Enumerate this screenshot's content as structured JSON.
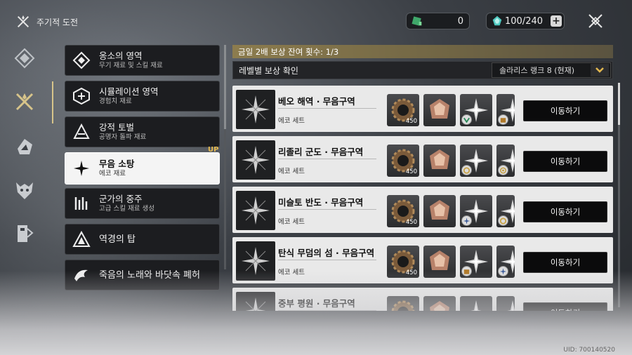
{
  "header": {
    "title": "주기적 도전"
  },
  "currency": {
    "green_value": "0",
    "stamina_value": "100/240"
  },
  "categories": [
    {
      "title": "옹소의 영역",
      "desc": "무기 재료 및 스킬 재료"
    },
    {
      "title": "시뮬레이션 영역",
      "desc": "경험치 재료"
    },
    {
      "title": "강적 토벌",
      "desc": "공명자 돌파 재료"
    },
    {
      "title": "무음 소탕",
      "desc": "에코 재료"
    },
    {
      "title": "군가의 중주",
      "desc": "고급 스킬 재료 생성"
    },
    {
      "title": "역경의 탑",
      "desc": ""
    },
    {
      "title": "죽음의 노래와 바닷속 폐허",
      "desc": ""
    }
  ],
  "up_badge": "UP",
  "banner": "금일 2배 보상 잔여 횟수: 1/3",
  "subheader": {
    "label": "레벨별 보상 확인",
    "dropdown_value": "솔라리스 랭크 8 (현재)"
  },
  "rows": [
    {
      "name": "베오 해역 · 무음구역",
      "set": "에코 세트",
      "count1": "450",
      "go": "이동하기"
    },
    {
      "name": "리졸리 군도 · 무음구역",
      "set": "에코 세트",
      "count1": "450",
      "go": "이동하기"
    },
    {
      "name": "미슬토 반도 · 무음구역",
      "set": "에코 세트",
      "count1": "450",
      "go": "이동하기"
    },
    {
      "name": "탄식 무덤의 섬 · 무음구역",
      "set": "에코 세트",
      "count1": "450",
      "go": "이동하기"
    },
    {
      "name": "중부 평원 · 무음구역",
      "set": "",
      "count1": "",
      "go": "이동하기"
    }
  ],
  "uid": "UID: 700140520",
  "icons": [
    "crossed-swords-icon",
    "diamond-compass-icon",
    "crossed-blades-icon",
    "wing-icon",
    "demon-mask-icon",
    "door-icon",
    "close-icon",
    "plus-icon",
    "chevron-down-icon"
  ],
  "colors": {
    "accent_gold": "#d7c48a",
    "banner_gold": "#8c7c4e",
    "row_bg": "#e9e9e9",
    "go_button": "#0b0b0c"
  }
}
